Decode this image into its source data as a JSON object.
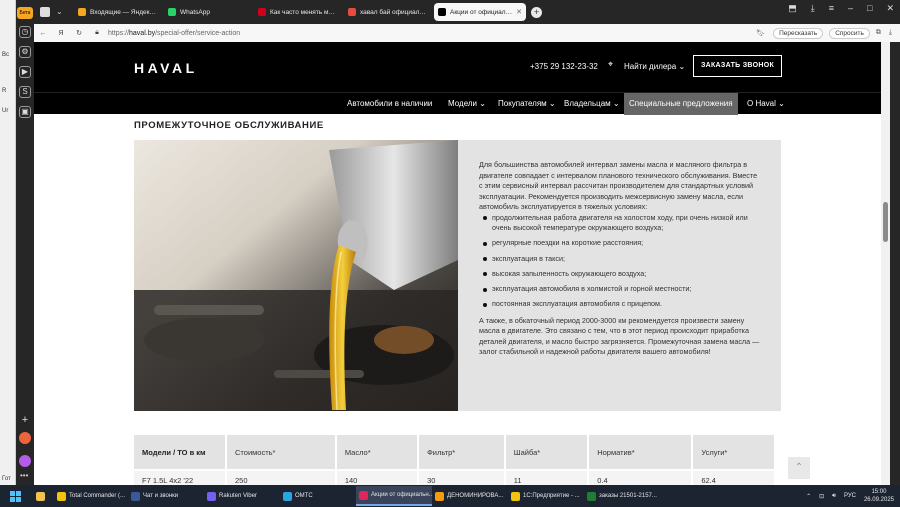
{
  "browser": {
    "tabs": [
      {
        "label": "Входящие — Яндекс Почта",
        "color": "#f5a623"
      },
      {
        "label": "WhatsApp",
        "color": "#25d366"
      },
      {
        "label": "Как часто менять моторное масло",
        "color": "#d0021b"
      },
      {
        "label": "хавал бай официальный",
        "color": "#e74c3c"
      },
      {
        "label": "Акции от официального дилера",
        "color": "#000000",
        "active": true
      }
    ],
    "badge": "Бета",
    "url_host": "haval.by",
    "url_path": "/special-offer/service-action",
    "url_scheme": "https://",
    "translate_label": "Пересказать",
    "ask_label": "Спросить"
  },
  "site": {
    "logo": "HAVAL",
    "phone": "+375 29 132-23-32",
    "find_dealer": "Найти дилера",
    "callback": "ЗАКАЗАТЬ ЗВОНОК",
    "nav": [
      {
        "label": "Автомобили в наличии",
        "chevron": false
      },
      {
        "label": "Модели",
        "chevron": true
      },
      {
        "label": "Покупателям",
        "chevron": true
      },
      {
        "label": "Владельцам",
        "chevron": true
      },
      {
        "label": "Специальные предложения",
        "chevron": false,
        "active": true
      },
      {
        "label": "О Haval",
        "chevron": true
      }
    ],
    "section_title": "ПРОМЕЖУТОЧНОЕ ОБСЛУЖИВАНИЕ",
    "intro": "Для большинства автомобилей интервал замены масла и масляного фильтра в двигателе совпадает с интервалом планового технического обслуживания. Вместе с этим сервисный интервал рассчитан производителем для стандартных условий эксплуатации. Рекомендуется производить межсервисную замену масла, если автомобиль эксплуатируется в тяжелых условиях:",
    "conditions": [
      "продолжительная работа двигателя на холостом ходу, при очень низкой или очень высокой температуре окружающего воздуха;",
      "регулярные поездки на короткие расстояния;",
      "эксплуатация в такси;",
      "высокая запыленность окружающего воздуха;",
      "эксплуатация автомобиля в холмистой и горной местности;",
      "постоянная эксплуатация автомобиля с прицепом."
    ],
    "outro": "А также, в обкаточный период 2000-3000 км рекомендуется произвести замену масла в двигателе. Это связано с тем, что в этот период происходит приработка деталей двигателя, и масло быстро загрязняется. Промежуточная замена масла — залог стабильной и надежной работы двигателя вашего автомобиля!",
    "table": {
      "headers": [
        "Модели / ТО в км",
        "Стоимость*",
        "Масло*",
        "Фильтр*",
        "Шайба*",
        "Норматив*",
        "Услуги*"
      ],
      "rows": [
        [
          "F7 1.5L 4x2 '22",
          "250",
          "140",
          "30",
          "11",
          "0.4",
          "62.4"
        ]
      ]
    }
  },
  "taskbar": {
    "items": [
      {
        "label": "Total Commander (...",
        "color": "#f1c40f"
      },
      {
        "label": "Чат и звонки",
        "color": "#3b5998"
      },
      {
        "label": "Rakuten Viber",
        "color": "#7360f2"
      },
      {
        "label": "ОМТС",
        "color": "#2aa5e0"
      },
      {
        "label": "Акции от официальн...",
        "color": "#e0245e",
        "active": true
      },
      {
        "label": "ДЕНОМИНИРОВА...",
        "color": "#f39c12"
      },
      {
        "label": "1С:Предприятие - ...",
        "color": "#f1c40f"
      },
      {
        "label": "заказы 21501-2157...",
        "color": "#1e7e34"
      }
    ],
    "lang": "РУС",
    "time": "15:00",
    "date": "26.09.2025"
  }
}
